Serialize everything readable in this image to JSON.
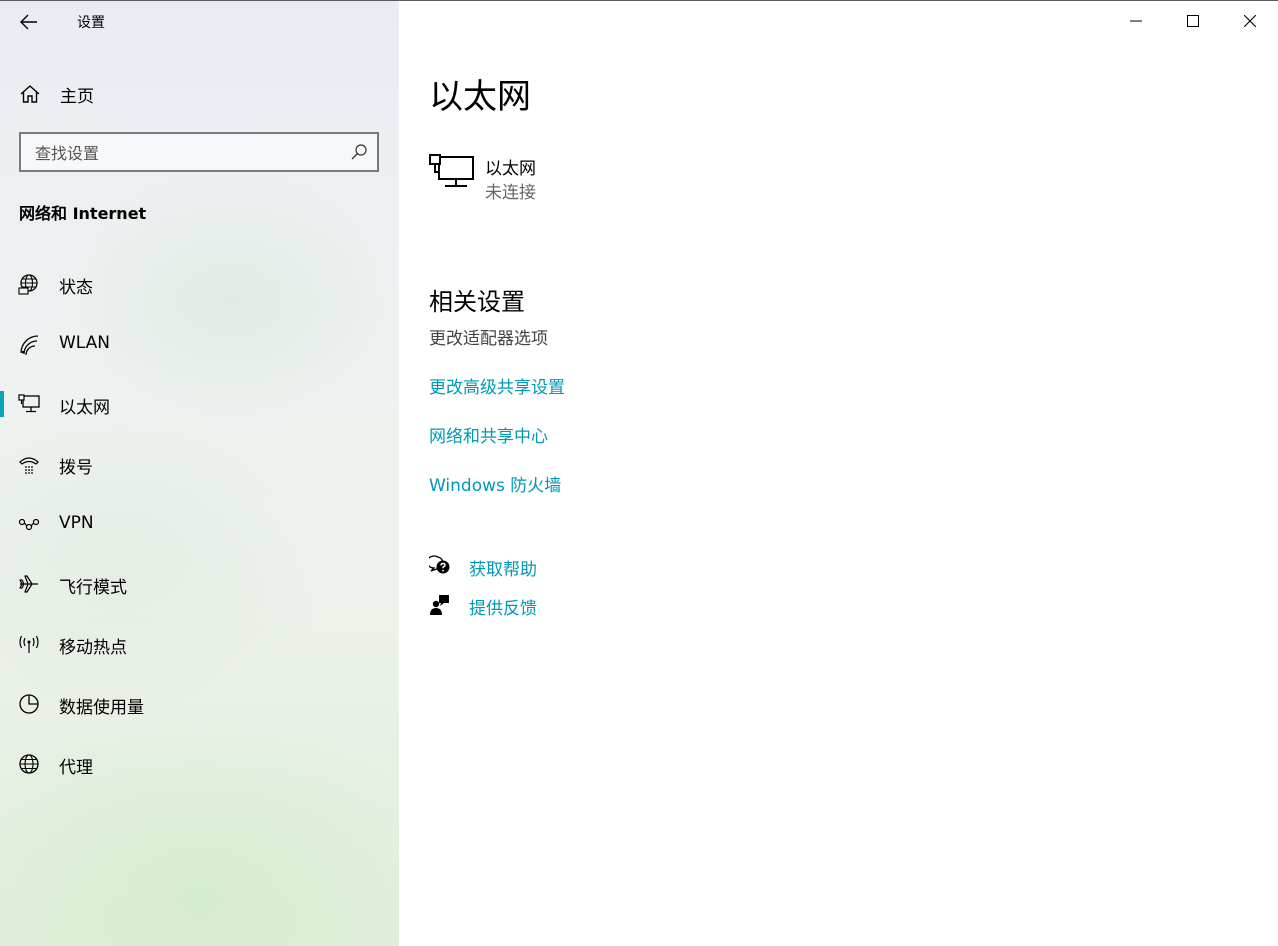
{
  "window": {
    "title": "设置",
    "controls": {
      "minimize": "minimize",
      "maximize": "maximize",
      "close": "close"
    }
  },
  "sidebar": {
    "home_label": "主页",
    "search_placeholder": "查找设置",
    "section_title": "网络和 Internet",
    "items": [
      {
        "label": "状态",
        "icon": "globe-status-icon"
      },
      {
        "label": "WLAN",
        "icon": "wifi-icon"
      },
      {
        "label": "以太网",
        "icon": "ethernet-icon",
        "active": true
      },
      {
        "label": "拨号",
        "icon": "dialup-icon"
      },
      {
        "label": "VPN",
        "icon": "vpn-icon"
      },
      {
        "label": "飞行模式",
        "icon": "airplane-icon"
      },
      {
        "label": "移动热点",
        "icon": "hotspot-icon"
      },
      {
        "label": "数据使用量",
        "icon": "data-usage-icon"
      },
      {
        "label": "代理",
        "icon": "globe-proxy-icon"
      }
    ]
  },
  "main": {
    "title": "以太网",
    "adapter": {
      "name": "以太网",
      "status": "未连接"
    },
    "related": {
      "title": "相关设置",
      "subtitle": "更改适配器选项",
      "links": [
        "更改高级共享设置",
        "网络和共享中心",
        "Windows 防火墙"
      ]
    },
    "help": {
      "get_help": "获取帮助",
      "feedback": "提供反馈"
    }
  },
  "colors": {
    "accent": "#0aa3b9",
    "link": "#0099b5"
  }
}
